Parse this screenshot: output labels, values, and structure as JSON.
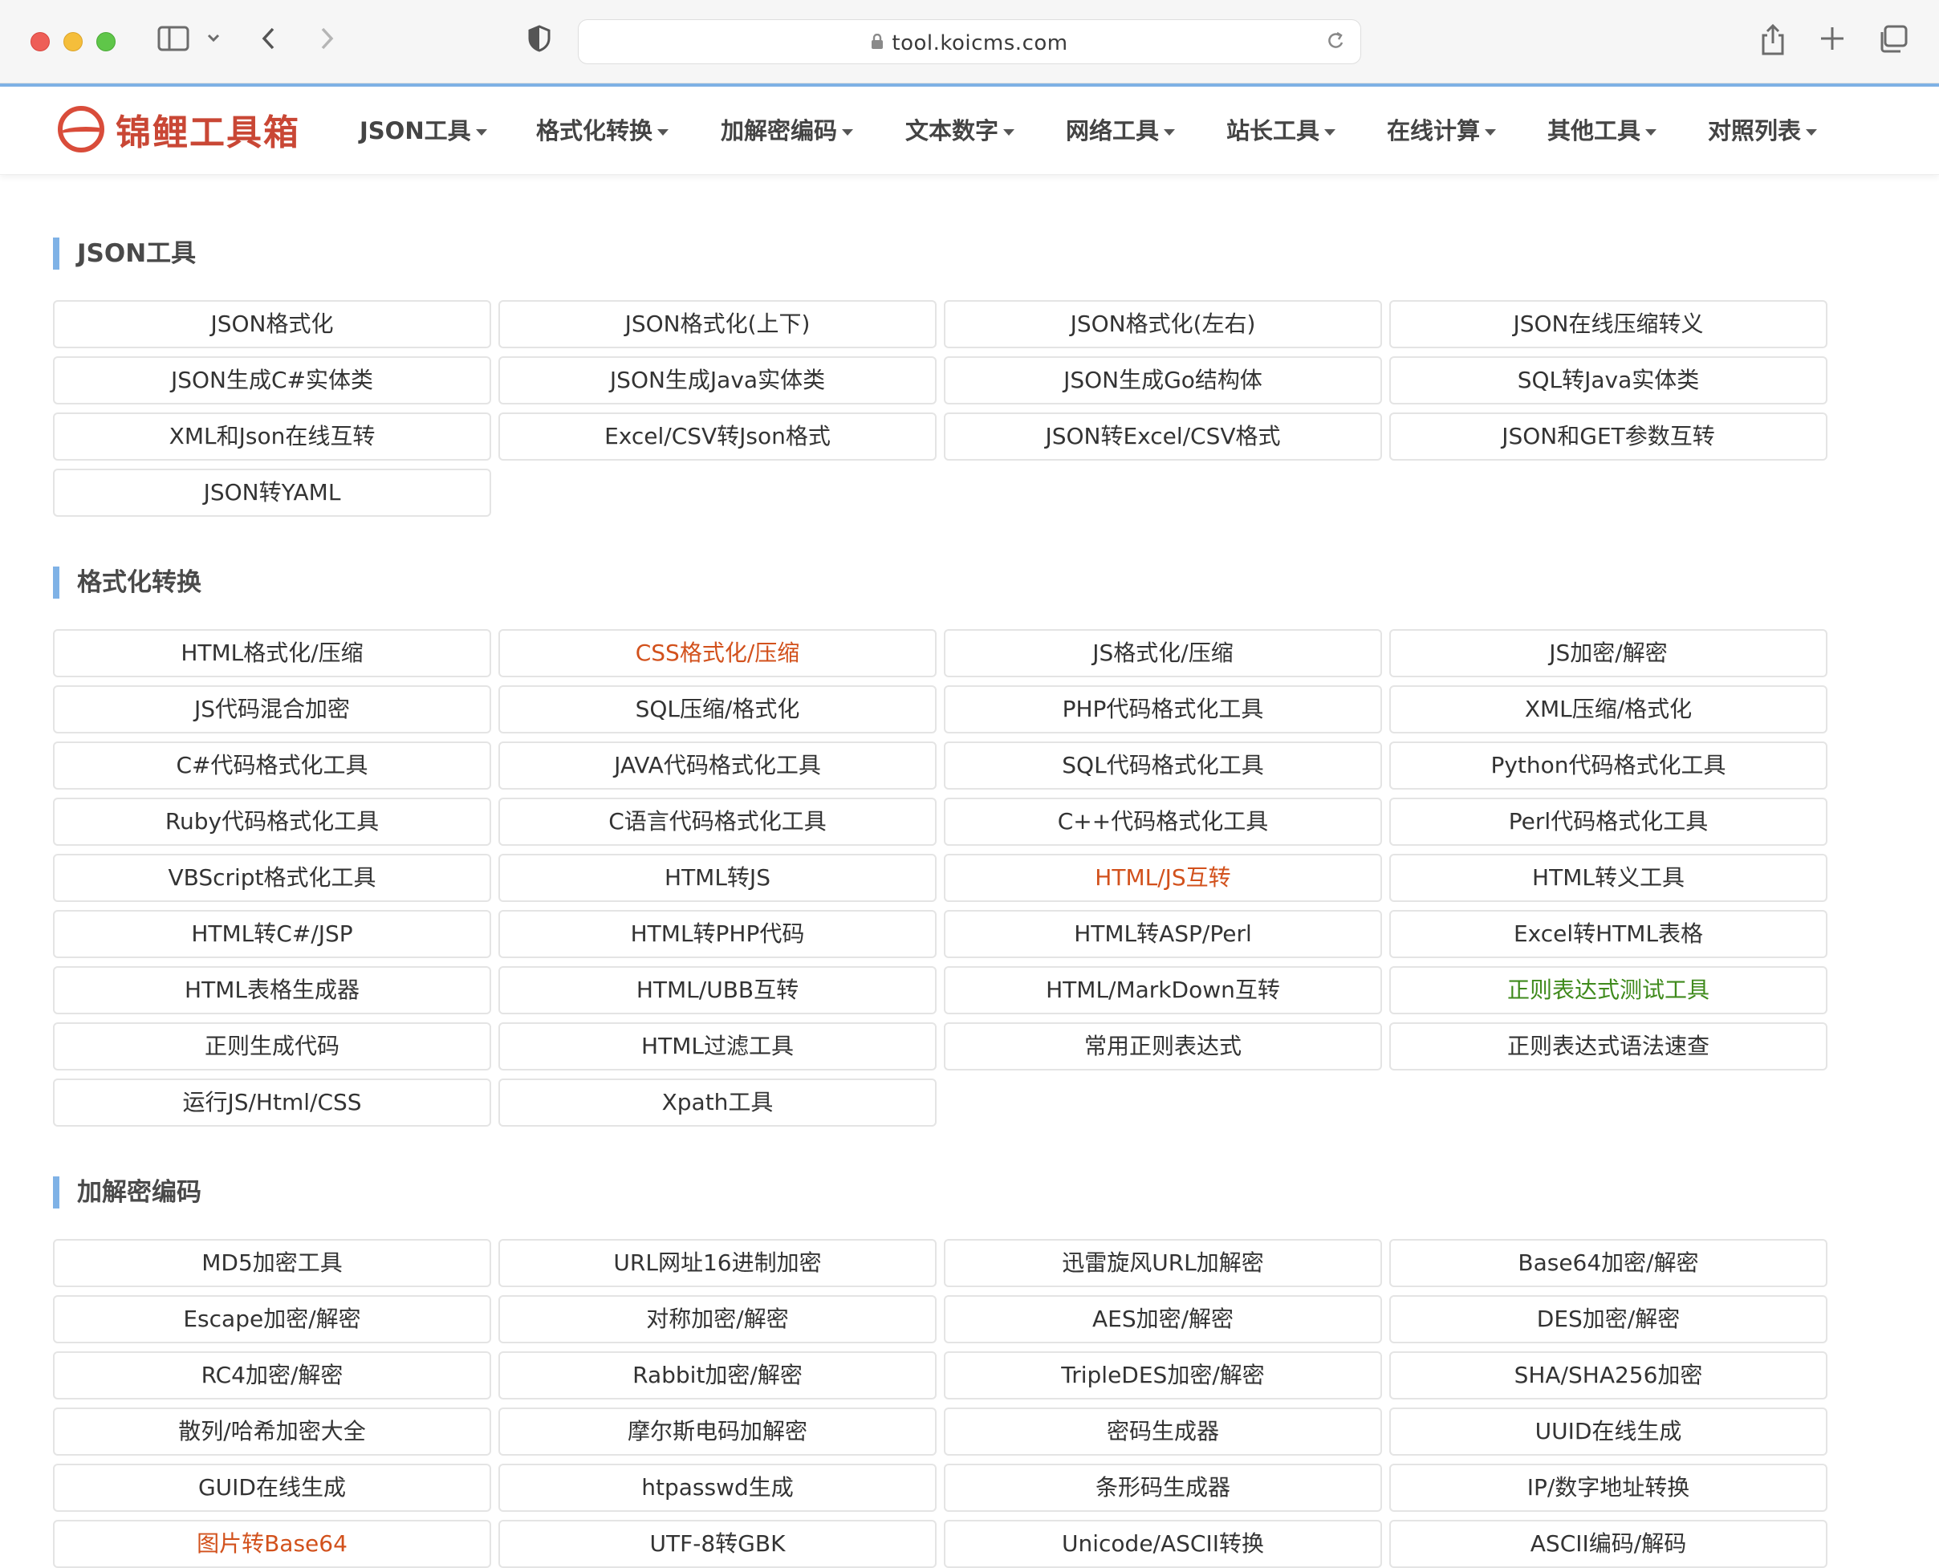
{
  "browser": {
    "url": "tool.koicms.com",
    "icons": [
      "sidebar-toggle-icon",
      "chevron-down-icon",
      "back-icon",
      "forward-icon",
      "shield-icon",
      "lock-icon",
      "reload-icon",
      "share-icon",
      "new-tab-icon",
      "tabs-overview-icon"
    ]
  },
  "site": {
    "logo_text": "锦鲤工具箱",
    "nav": [
      {
        "label": "JSON工具"
      },
      {
        "label": "格式化转换"
      },
      {
        "label": "加解密编码"
      },
      {
        "label": "文本数字"
      },
      {
        "label": "网络工具"
      },
      {
        "label": "站长工具"
      },
      {
        "label": "在线计算"
      },
      {
        "label": "其他工具"
      },
      {
        "label": "对照列表"
      }
    ]
  },
  "colors": {
    "accent_blue": "#7fb2e6",
    "highlight_orange": "#d2511c",
    "highlight_green": "#3f8a1c",
    "brand_red": "#c94735"
  },
  "sections": [
    {
      "title": "JSON工具",
      "tools": [
        {
          "label": "JSON格式化"
        },
        {
          "label": "JSON格式化(上下)"
        },
        {
          "label": "JSON格式化(左右)"
        },
        {
          "label": "JSON在线压缩转义"
        },
        {
          "label": "JSON生成C#实体类"
        },
        {
          "label": "JSON生成Java实体类"
        },
        {
          "label": "JSON生成Go结构体"
        },
        {
          "label": "SQL转Java实体类"
        },
        {
          "label": "XML和Json在线互转"
        },
        {
          "label": "Excel/CSV转Json格式"
        },
        {
          "label": "JSON转Excel/CSV格式"
        },
        {
          "label": "JSON和GET参数互转"
        },
        {
          "label": "JSON转YAML"
        }
      ]
    },
    {
      "title": "格式化转换",
      "tools": [
        {
          "label": "HTML格式化/压缩"
        },
        {
          "label": "CSS格式化/压缩",
          "highlight": "orange"
        },
        {
          "label": "JS格式化/压缩"
        },
        {
          "label": "JS加密/解密"
        },
        {
          "label": "JS代码混合加密"
        },
        {
          "label": "SQL压缩/格式化"
        },
        {
          "label": "PHP代码格式化工具"
        },
        {
          "label": "XML压缩/格式化"
        },
        {
          "label": "C#代码格式化工具"
        },
        {
          "label": "JAVA代码格式化工具"
        },
        {
          "label": "SQL代码格式化工具"
        },
        {
          "label": "Python代码格式化工具"
        },
        {
          "label": "Ruby代码格式化工具"
        },
        {
          "label": "C语言代码格式化工具"
        },
        {
          "label": "C++代码格式化工具"
        },
        {
          "label": "Perl代码格式化工具"
        },
        {
          "label": "VBScript格式化工具"
        },
        {
          "label": "HTML转JS"
        },
        {
          "label": "HTML/JS互转",
          "highlight": "orange"
        },
        {
          "label": "HTML转义工具"
        },
        {
          "label": "HTML转C#/JSP"
        },
        {
          "label": "HTML转PHP代码"
        },
        {
          "label": "HTML转ASP/Perl"
        },
        {
          "label": "Excel转HTML表格"
        },
        {
          "label": "HTML表格生成器"
        },
        {
          "label": "HTML/UBB互转"
        },
        {
          "label": "HTML/MarkDown互转"
        },
        {
          "label": "正则表达式测试工具",
          "highlight": "green"
        },
        {
          "label": "正则生成代码"
        },
        {
          "label": "HTML过滤工具"
        },
        {
          "label": "常用正则表达式"
        },
        {
          "label": "正则表达式语法速查"
        },
        {
          "label": "运行JS/Html/CSS"
        },
        {
          "label": "Xpath工具"
        }
      ]
    },
    {
      "title": "加解密编码",
      "tools": [
        {
          "label": "MD5加密工具"
        },
        {
          "label": "URL网址16进制加密"
        },
        {
          "label": "迅雷旋风URL加解密"
        },
        {
          "label": "Base64加密/解密"
        },
        {
          "label": "Escape加密/解密"
        },
        {
          "label": "对称加密/解密"
        },
        {
          "label": "AES加密/解密"
        },
        {
          "label": "DES加密/解密"
        },
        {
          "label": "RC4加密/解密"
        },
        {
          "label": "Rabbit加密/解密"
        },
        {
          "label": "TripleDES加密/解密"
        },
        {
          "label": "SHA/SHA256加密"
        },
        {
          "label": "散列/哈希加密大全"
        },
        {
          "label": "摩尔斯电码加解密"
        },
        {
          "label": "密码生成器"
        },
        {
          "label": "UUID在线生成"
        },
        {
          "label": "GUID在线生成"
        },
        {
          "label": "htpasswd生成"
        },
        {
          "label": "条形码生成器"
        },
        {
          "label": "IP/数字地址转换"
        },
        {
          "label": "图片转Base64",
          "highlight": "orange"
        },
        {
          "label": "UTF-8转GBK"
        },
        {
          "label": "Unicode/ASCII转换"
        },
        {
          "label": "ASCII编码/解码"
        }
      ]
    }
  ]
}
